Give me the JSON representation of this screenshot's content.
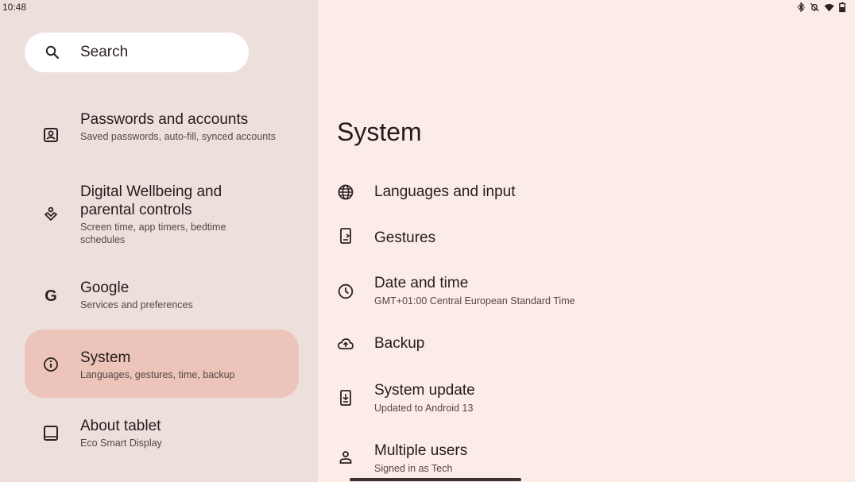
{
  "status_bar": {
    "time": "10:48",
    "icons": [
      "bluetooth-icon",
      "notifications-off-icon",
      "wifi-icon",
      "battery-icon"
    ]
  },
  "search": {
    "label": "Search"
  },
  "sidebar": {
    "items": [
      {
        "title": "Passwords and accounts",
        "subtitle": "Saved passwords, auto-fill, synced accounts",
        "icon": "account-box-icon"
      },
      {
        "title": "Digital Wellbeing and parental controls",
        "subtitle": "Screen time, app timers, bedtime schedules",
        "icon": "wellbeing-icon"
      },
      {
        "title": "Google",
        "subtitle": "Services and preferences",
        "icon": "google-icon"
      },
      {
        "title": "System",
        "subtitle": "Languages, gestures, time, backup",
        "icon": "info-icon",
        "selected": true
      },
      {
        "title": "About tablet",
        "subtitle": "Eco Smart Display",
        "icon": "tablet-icon"
      }
    ]
  },
  "main": {
    "title": "System",
    "rows": [
      {
        "title": "Languages and input",
        "subtitle": "",
        "icon": "globe-icon"
      },
      {
        "title": "Gestures",
        "subtitle": "",
        "icon": "gesture-phone-icon"
      },
      {
        "title": "Date and time",
        "subtitle": "GMT+01:00 Central European Standard Time",
        "icon": "clock-icon"
      },
      {
        "title": "Backup",
        "subtitle": "",
        "icon": "cloud-upload-icon"
      },
      {
        "title": "System update",
        "subtitle": "Updated to Android 13",
        "icon": "system-update-icon"
      },
      {
        "title": "Multiple users",
        "subtitle": "Signed in as Tech",
        "icon": "person-icon"
      }
    ]
  },
  "colors": {
    "left_pane_bg": "#ede0dc",
    "right_pane_bg": "#fbece8",
    "selected_bg": "#ecc4b9",
    "text_primary": "#241c1c",
    "text_secondary": "#564545"
  }
}
